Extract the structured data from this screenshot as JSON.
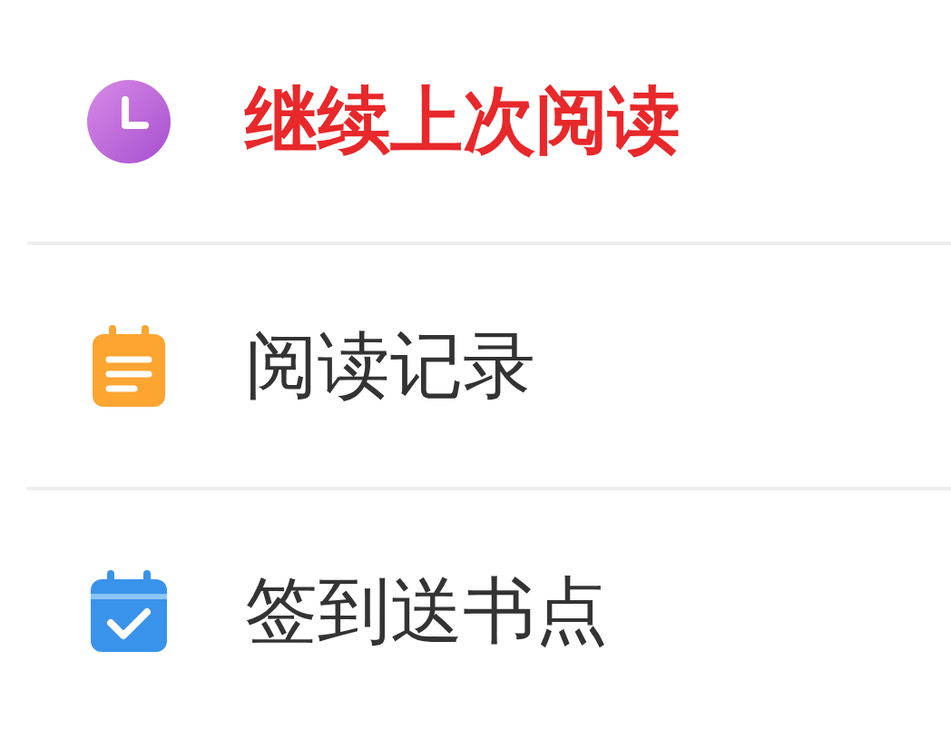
{
  "menu": [
    {
      "kind": "clock",
      "label": "继续上次阅读",
      "highlighted": true
    },
    {
      "kind": "notes",
      "label": "阅读记录",
      "highlighted": false
    },
    {
      "kind": "calendar",
      "label": "签到送书点",
      "highlighted": false
    }
  ]
}
